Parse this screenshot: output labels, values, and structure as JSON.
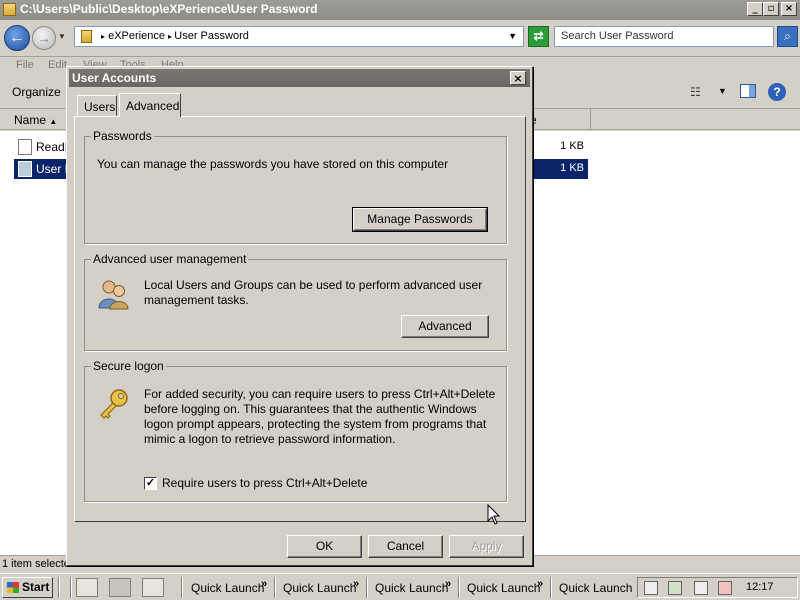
{
  "explorer": {
    "title": "C:\\Users\\Public\\Desktop\\eXPerience\\User Password",
    "breadcrumb": [
      "eXPerience",
      "User Password"
    ],
    "search_placeholder": "Search User Password",
    "menu": [
      "File",
      "Edit",
      "View",
      "Tools",
      "Help"
    ],
    "organize_label": "Organize",
    "column_name": "Name",
    "column_e": "e",
    "files": [
      {
        "name": "ReadM",
        "size": "1 KB",
        "selected": false
      },
      {
        "name": "User P",
        "size": "1 KB",
        "selected": true
      }
    ],
    "status": "1 item selecte"
  },
  "dialog": {
    "title": "User Accounts",
    "tabs": [
      "Users",
      "Advanced"
    ],
    "active_tab": "Advanced",
    "passwords": {
      "label": "Passwords",
      "text": "You can manage the passwords you have stored on this computer",
      "button": "Manage Passwords"
    },
    "advanced_mgmt": {
      "label": "Advanced user management",
      "text": "Local Users and Groups can be used to perform advanced user management tasks.",
      "button": "Advanced"
    },
    "secure_logon": {
      "label": "Secure logon",
      "text": "For added security, you can require users to press Ctrl+Alt+Delete before logging on. This guarantees that the authentic Windows logon prompt appears, protecting the system from programs that mimic a logon to retrieve password information.",
      "checkbox_label": "Require users to press Ctrl+Alt+Delete",
      "checked": true
    },
    "ok": "OK",
    "cancel": "Cancel",
    "apply": "Apply"
  },
  "taskbar": {
    "start": "Start",
    "quick_launch": [
      "Quick Launch",
      "Quick Launch",
      "Quick Launch",
      "Quick Launch",
      "Quick Launch"
    ],
    "chevron": "»",
    "clock": "12:17"
  }
}
